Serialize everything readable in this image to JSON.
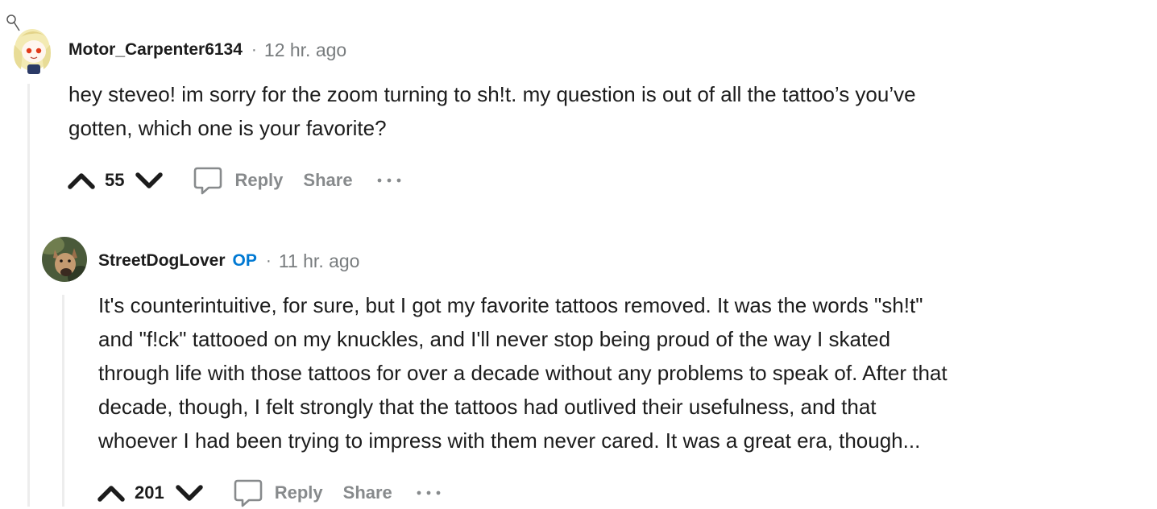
{
  "comments": [
    {
      "username": "Motor_Carpenter6134",
      "separator": "·",
      "timestamp": "12 hr. ago",
      "body": [
        "hey steveo! im sorry for the zoom turning to sh!t. my question is out of all the tattoo’s you’ve",
        "gotten, which one is your favorite?"
      ],
      "score": "55",
      "reply_label": "Reply",
      "share_label": "Share",
      "more_label": "···",
      "avatar_icon": "snoo-avatar-icon"
    },
    {
      "username": "StreetDogLover",
      "op_badge": "OP",
      "separator": "·",
      "timestamp": "11 hr. ago",
      "body": [
        "It's counterintuitive, for sure, but I got my favorite tattoos removed. It was the words \"sh!t\"",
        "and \"f!ck\" tattooed on my knuckles, and I'll never stop being proud of the way I skated",
        "through life with those tattoos for over a decade without any problems to speak of. After that",
        "decade, though, I felt strongly that the tattoos had outlived their usefulness, and that",
        "whoever I had been trying to impress with them never cared. It was a great era, though..."
      ],
      "score": "201",
      "reply_label": "Reply",
      "share_label": "Share",
      "more_label": "···",
      "avatar_icon": "dog-photo-avatar"
    }
  ],
  "colors": {
    "text": "#1c1c1c",
    "muted": "#787c7e",
    "action": "#878a8c",
    "op": "#0079d3",
    "thread_line": "#ededed"
  }
}
